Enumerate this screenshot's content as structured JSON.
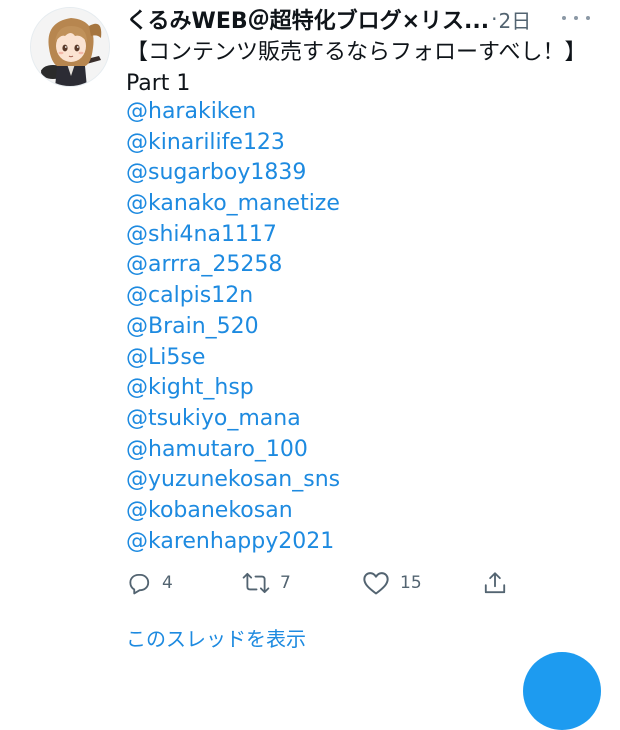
{
  "tweet": {
    "author": "くるみWEB＠超特化ブログ×リス...",
    "separator": "·",
    "time": "2日",
    "text": "【コンテンツ販売するならフォローすべし！】Part 1",
    "mentions": [
      "@harakiken",
      "@kinarilife123",
      "@sugarboy1839",
      "@kanako_manetize",
      "@shi4na1117",
      "@arrra_25258",
      "@calpis12n",
      "@Brain_520",
      "@Li5se",
      "@kight_hsp",
      "@tsukiyo_mana",
      "@hamutaro_100",
      "@yuzunekosan_sns",
      "@kobanekosan",
      "@karenhappy2021"
    ],
    "actions": {
      "reply_count": "4",
      "retweet_count": "7",
      "like_count": "15"
    },
    "show_thread": "このスレッドを表示"
  },
  "colors": {
    "link": "#1d8ae0",
    "text": "#0f1419",
    "muted": "#536471",
    "fab": "#1d9bf0"
  },
  "icons": {
    "more": "more-horizontal-icon",
    "reply": "reply-icon",
    "retweet": "retweet-icon",
    "like": "heart-icon",
    "share": "share-icon",
    "compose": "compose-fab"
  }
}
